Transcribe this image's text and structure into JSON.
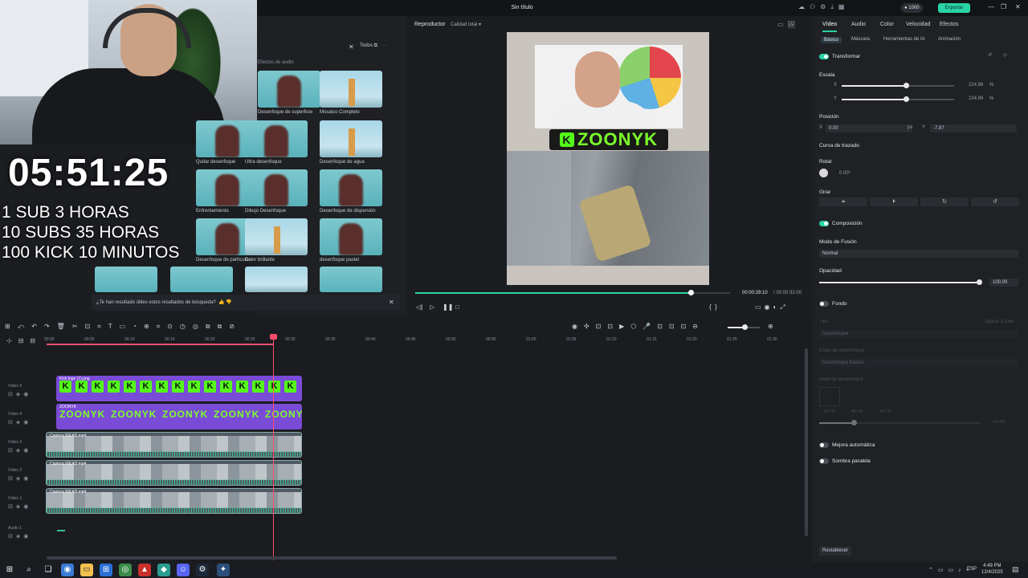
{
  "window": {
    "title": "Sin título",
    "credits": "1000",
    "export_label": "Exportar"
  },
  "overlay": {
    "timer": "05:51:25",
    "lines": [
      "1 SUB 3 HORAS",
      "10 SUBS 35 HORAS",
      "100 KICK 10 MINUTOS"
    ]
  },
  "effects": {
    "filter_label": "Todos",
    "category": "Efectos de audio",
    "items": [
      {
        "label": "Desenfoque de superficie",
        "kind": "pink"
      },
      {
        "label": "Mosaico Completo",
        "kind": "tower"
      },
      {
        "label": "Quitar desenfoque",
        "kind": "pink"
      },
      {
        "label": "Ultra desenfoque",
        "kind": "pink"
      },
      {
        "label": "Desenfoque de agua",
        "kind": "tower"
      },
      {
        "label": "Enfrentamiento",
        "kind": "pink"
      },
      {
        "label": "Dibujo Desenfoque",
        "kind": "pink"
      },
      {
        "label": "Desenfoque de dispersión",
        "kind": "pink"
      },
      {
        "label": "Desenfoque de partículas",
        "kind": "pink"
      },
      {
        "label": "Color brillante",
        "kind": "tower"
      },
      {
        "label": "desenfoque pastel",
        "kind": "pink"
      }
    ],
    "feedback": "¿Te han resultado útiles estos resultados de búsqueda?"
  },
  "player": {
    "label": "Reproductor",
    "quality": "Calidad total",
    "brand_text": "ZOONYK",
    "brand_letter": "K",
    "current_time": "00:00:28:10",
    "total_time": "/ 00:00:32:00",
    "progress": 0.875
  },
  "properties": {
    "tabs": [
      "Vídeo",
      "Audio",
      "Color",
      "Velocidad",
      "Efectos"
    ],
    "subtabs": [
      "Básico",
      "Máscara",
      "Herramientas de IA",
      "Animación"
    ],
    "transform_label": "Transformar",
    "scale_label": "Escala",
    "scale_x": "224.96",
    "scale_y": "224.96",
    "scale_unit": "%",
    "position_label": "Posición",
    "pos_x": "0.00",
    "pos_y": "-7.87",
    "pos_unit": "px",
    "path_curve": "Curva de trazado",
    "rotate_label": "Rotar",
    "rotate_value": "0.00°",
    "flip_label": "Girar",
    "composition_label": "Composición",
    "blend_label": "Modo de Fusión",
    "blend_value": "Normal",
    "opacity_label": "Opacidad",
    "opacity_value": "100.00",
    "fondo_label": "Fondo",
    "tipo_label": "Tipo",
    "apply_all": "Aplicar a todo",
    "tipo_value": "Desenfoque",
    "estilo_label": "Estilo de desenfoque",
    "estilo_value": "Desenfoque básico",
    "nivel_label": "Nivel de desenfoque",
    "nivel_opts": [
      "20 %",
      "40 %",
      "60 %"
    ],
    "nivel_value": "20.00",
    "auto_label": "Mejora automática",
    "shadow_label": "Sombra paralela",
    "reset_label": "Restablecer"
  },
  "timeline": {
    "ticks": [
      "00:00",
      "00:05",
      "00:10",
      "00:15",
      "00:20",
      "00:25",
      "00:30",
      "00:35",
      "00:40",
      "00:45",
      "00:50",
      "00:55",
      "01:00",
      "01:05",
      "01:10",
      "01:15",
      "01:20",
      "01:25",
      "01:30"
    ],
    "tracks": [
      {
        "name": "Vídeo 5",
        "clip": "Kick logo (1).png"
      },
      {
        "name": "Vídeo 4",
        "clip": "ZOONYK"
      },
      {
        "name": "Vídeo 3",
        "clip": "Captura WEAD.mp4"
      },
      {
        "name": "Vídeo 2",
        "clip": "Captura WEAD.mp4"
      },
      {
        "name": "Vídeo 1",
        "clip": "Captura WEAD.mp4"
      },
      {
        "name": "Audio 1",
        "clip": ""
      }
    ]
  },
  "taskbar": {
    "lang": "ESP",
    "time": "4:49 PM",
    "date": "12/4/2025"
  }
}
